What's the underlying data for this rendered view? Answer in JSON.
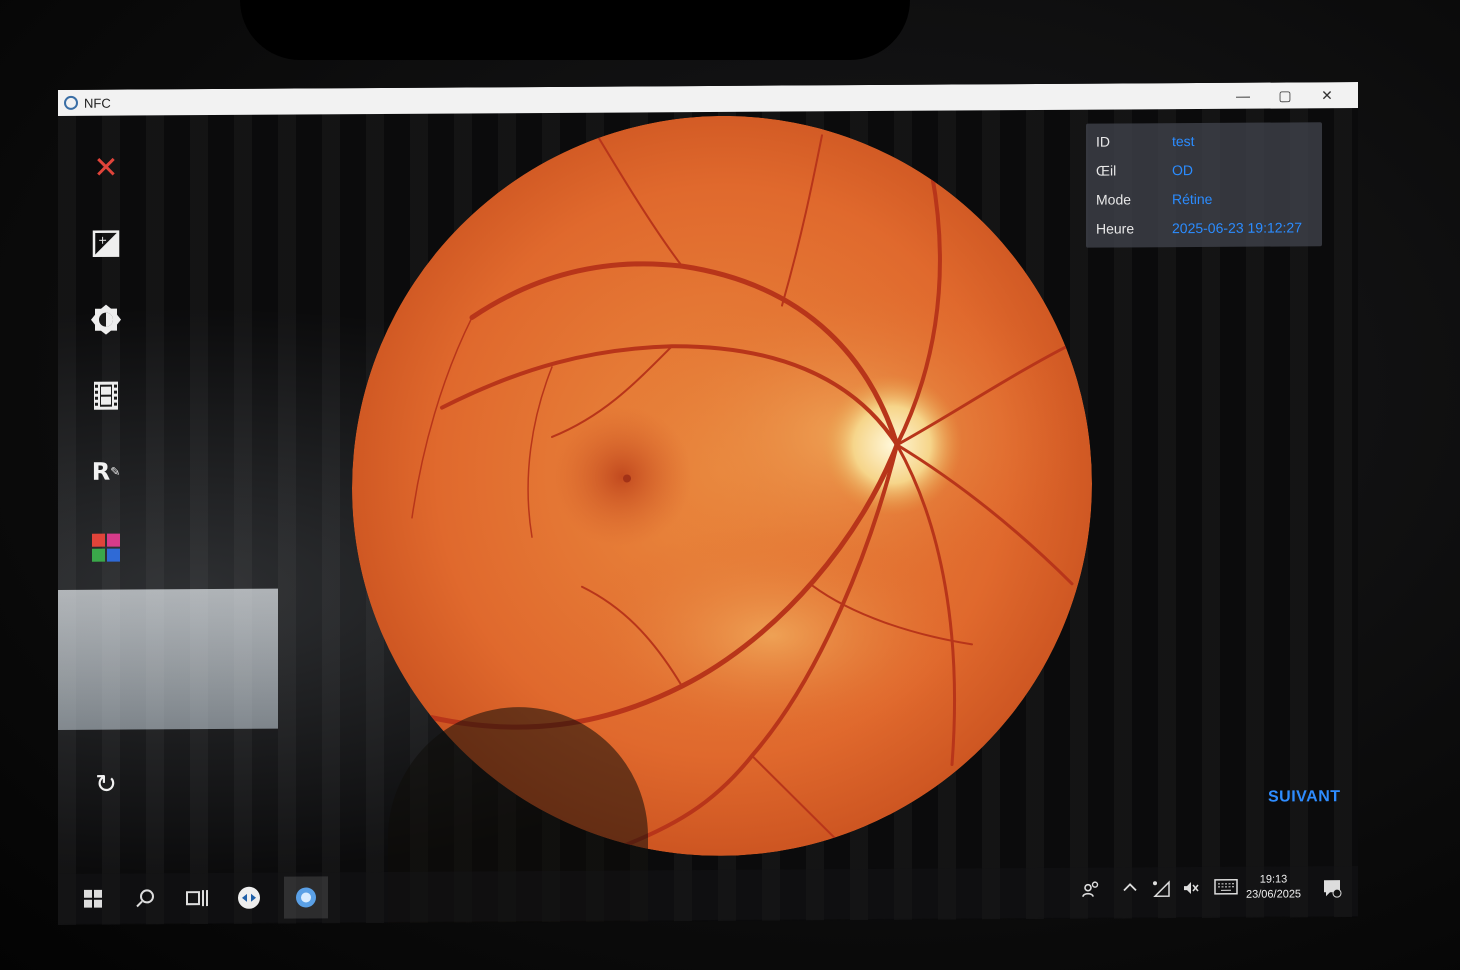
{
  "window": {
    "title": "NFC",
    "controls": {
      "minimize": "—",
      "maximize": "▢",
      "close": "✕"
    }
  },
  "toolbar": {
    "items": [
      {
        "icon": "close-icon",
        "glyph": "✕",
        "color": "#e0443a"
      },
      {
        "icon": "exposure-icon",
        "glyph": "⊞"
      },
      {
        "icon": "brightness-icon",
        "glyph": "◐"
      },
      {
        "icon": "film-icon",
        "glyph": "▤"
      },
      {
        "icon": "rx-icon",
        "glyph": "R"
      },
      {
        "icon": "color-channels-icon",
        "glyph": "■"
      },
      {
        "icon": "refresh-icon",
        "glyph": "↻"
      }
    ]
  },
  "info": {
    "rows": [
      {
        "label": "ID",
        "value": "test"
      },
      {
        "label": "Œil",
        "value": "OD"
      },
      {
        "label": "Mode",
        "value": "Rétine"
      },
      {
        "label": "Heure",
        "value": "2025-06-23 19:12:27"
      }
    ]
  },
  "actions": {
    "next_label": "SUIVANT"
  },
  "taskbar": {
    "start_icon": "windows-start-icon",
    "search_icon": "search-icon",
    "taskview_icon": "task-view-icon",
    "app1_icon": "remote-app-icon",
    "app2_icon": "nfc-app-icon",
    "tray": {
      "people": "people-icon",
      "chevron": "chevron-up-icon",
      "wifi": "wifi-icon",
      "volume": "volume-muted-icon",
      "keyboard": "keyboard-icon",
      "notification": "notification-icon"
    },
    "time": "19:13",
    "date": "23/06/2025"
  },
  "colors": {
    "accent": "#2e8cff",
    "close": "#e0443a",
    "fundus": "#e2702f"
  }
}
